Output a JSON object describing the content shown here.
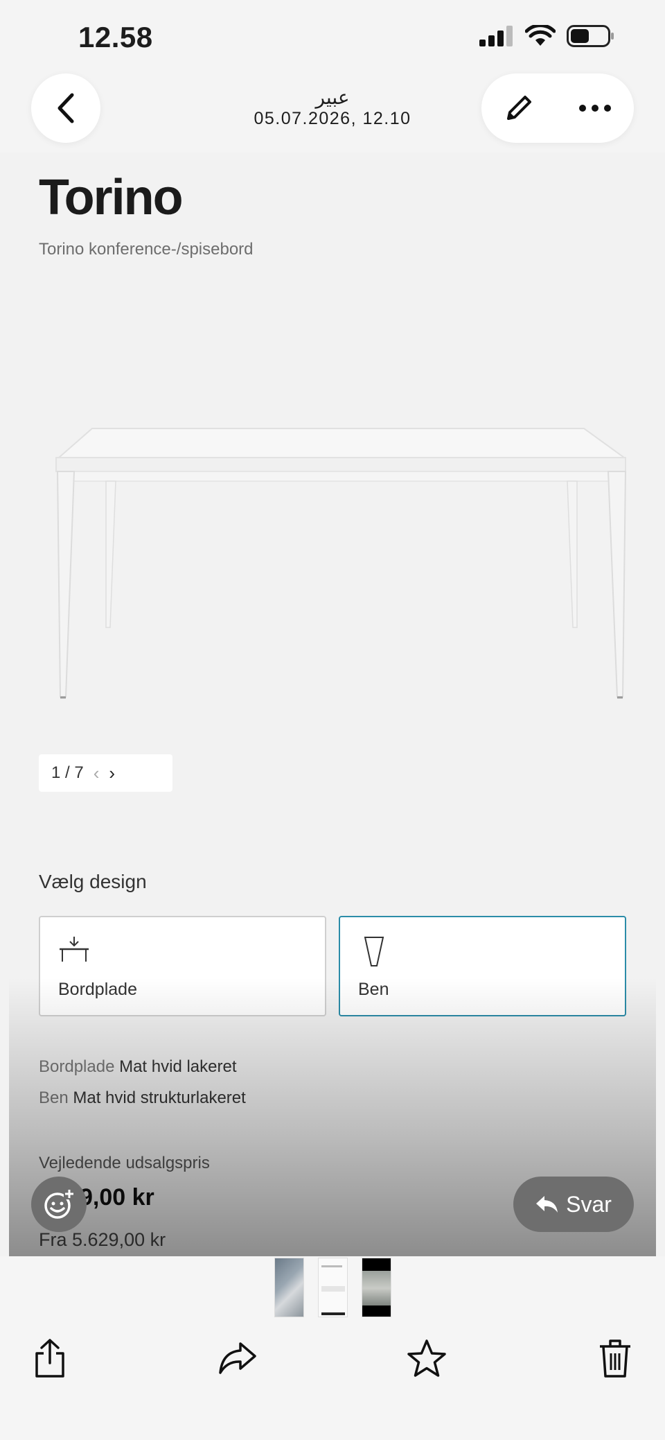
{
  "status_bar": {
    "time": "12.58"
  },
  "nav": {
    "sender": "عبير",
    "date": "05.07.2026, 12.10"
  },
  "content": {
    "title": "Torino",
    "subtitle": "Torino konference-/spisebord",
    "pager": {
      "text": "1 / 7",
      "prev": "‹",
      "next": "›"
    },
    "design_label": "Vælg design",
    "design_options": [
      {
        "label": "Bordplade",
        "selected": false
      },
      {
        "label": "Ben",
        "selected": true
      }
    ],
    "specs": [
      {
        "key": "Bordplade",
        "value": "Mat hvid lakeret"
      },
      {
        "key": "Ben",
        "value": "Mat hvid strukturlakeret"
      }
    ],
    "price_label": "Vejledende udsalgspris",
    "price_value": "9,00 kr",
    "price_from": "Fra 5.629,00 kr"
  },
  "actions": {
    "reply_label": "Svar"
  },
  "colors": {
    "selected_border": "#2b8ca8",
    "floating_button": "#6e6e6e"
  }
}
